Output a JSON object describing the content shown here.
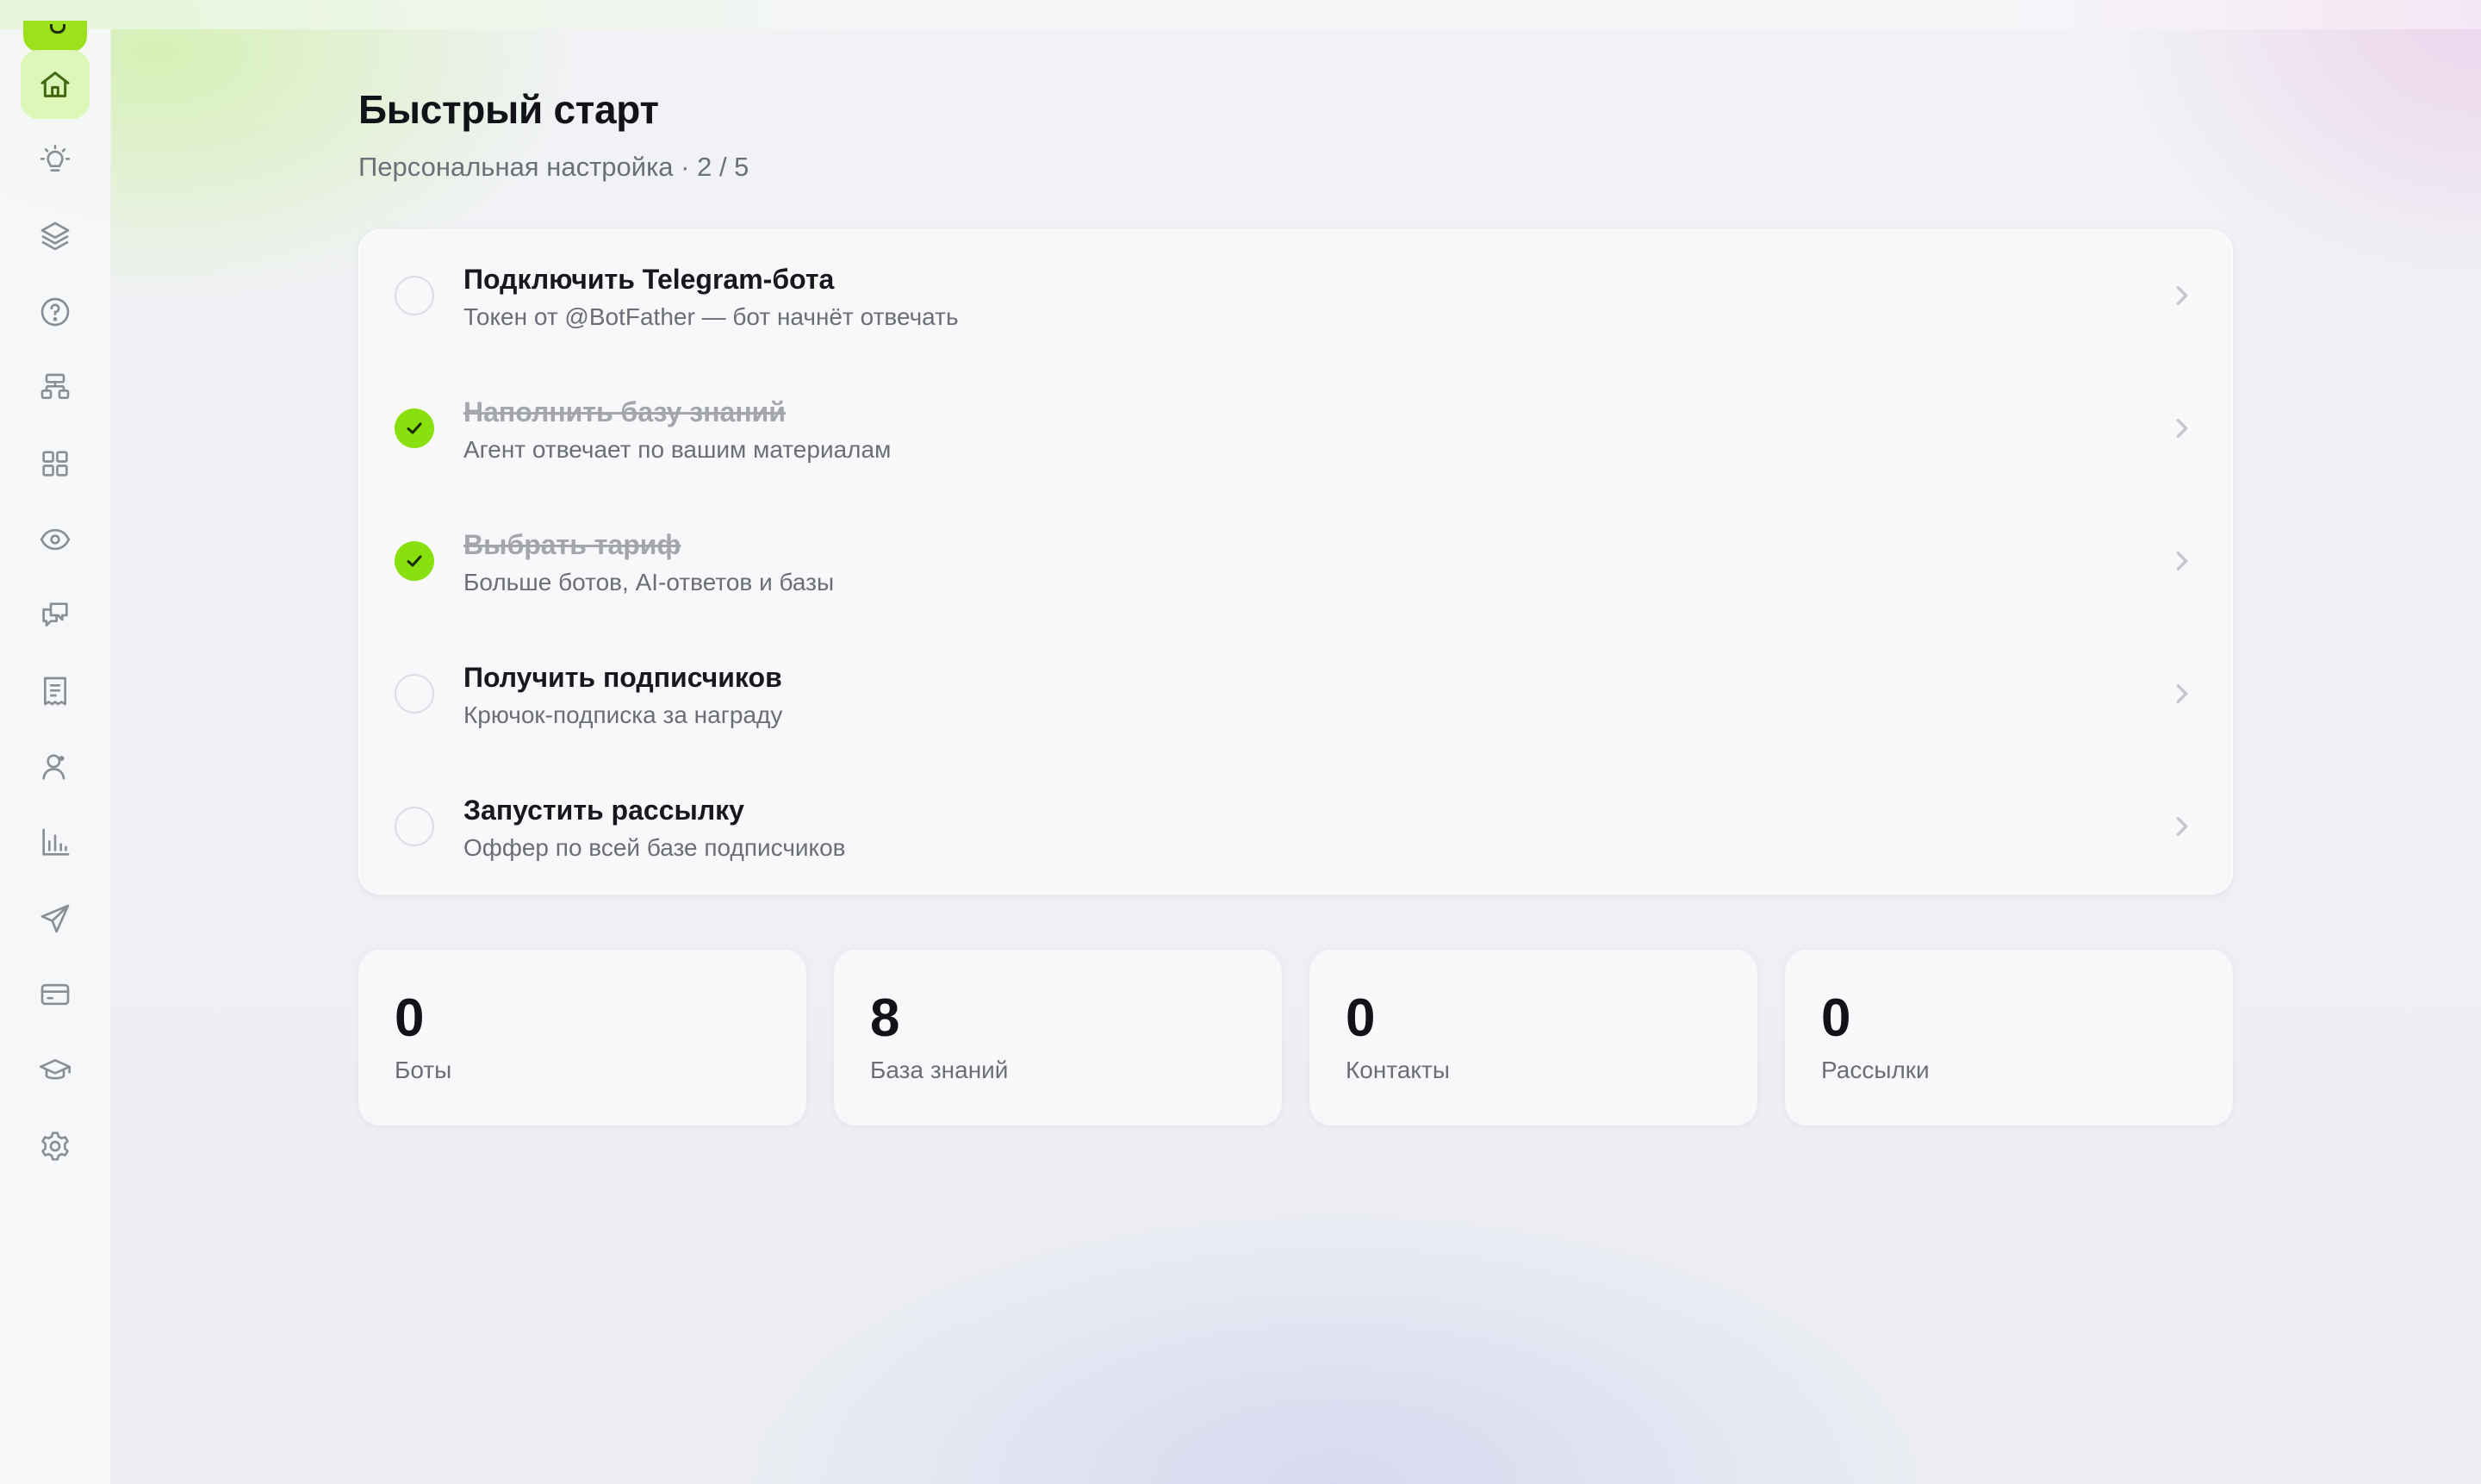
{
  "header": {
    "title": "Быстрый старт",
    "subtitle": "Персональная настройка · 2 / 5"
  },
  "sidebar": {
    "items": [
      {
        "icon": "home-icon",
        "active": true
      },
      {
        "icon": "lightbulb-icon"
      },
      {
        "icon": "layers-icon"
      },
      {
        "icon": "help-circle-icon"
      },
      {
        "icon": "flow-diagram-icon"
      },
      {
        "icon": "grid-icon"
      },
      {
        "icon": "eye-icon"
      },
      {
        "icon": "chat-bubbles-icon"
      },
      {
        "icon": "receipt-icon"
      },
      {
        "icon": "user-icon"
      },
      {
        "icon": "bar-chart-icon"
      },
      {
        "icon": "send-icon"
      },
      {
        "icon": "credit-card-icon"
      },
      {
        "icon": "graduation-cap-icon"
      },
      {
        "icon": "settings-gear-icon"
      }
    ]
  },
  "checklist": {
    "items": [
      {
        "title": "Подключить Telegram-бота",
        "description": "Токен от @BotFather — бот начнёт отвечать",
        "done": false
      },
      {
        "title": "Наполнить базу знаний",
        "description": "Агент отвечает по вашим материалам",
        "done": true
      },
      {
        "title": "Выбрать тариф",
        "description": "Больше ботов, AI-ответов и базы",
        "done": true
      },
      {
        "title": "Получить подписчиков",
        "description": "Крючок-подписка за награду",
        "done": false
      },
      {
        "title": "Запустить рассылку",
        "description": "Оффер по всей базе подписчиков",
        "done": false
      }
    ]
  },
  "stats": [
    {
      "value": "0",
      "label": "Боты"
    },
    {
      "value": "8",
      "label": "База знаний"
    },
    {
      "value": "0",
      "label": "Контакты"
    },
    {
      "value": "0",
      "label": "Рассылки"
    }
  ],
  "colors": {
    "accent": "#88e00f",
    "active_nav_bg": "#dcf7b7",
    "text_primary": "#111318",
    "text_secondary": "#6a6e77"
  }
}
